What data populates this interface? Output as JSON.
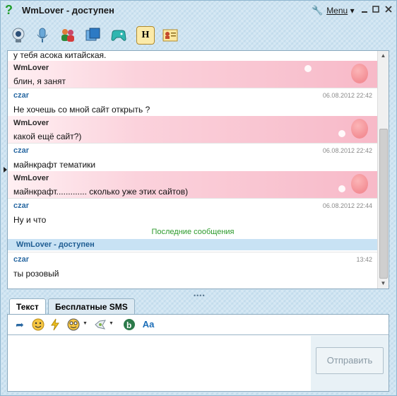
{
  "window": {
    "title": "WmLover - доступен",
    "menu_label": "Menu",
    "controls": [
      "minimize",
      "maximize",
      "close"
    ]
  },
  "toolbar": {
    "icons": [
      "webcam-icon",
      "microphone-icon",
      "contacts-icon",
      "windows-icon",
      "gamepad-icon",
      "h-icon",
      "contact-card-icon"
    ]
  },
  "chat": {
    "partial_line": "у тебя асока китайская.",
    "messages": [
      {
        "sender": "WmLover",
        "timestamp": "",
        "text": "блин, я занят",
        "kind": "partner"
      },
      {
        "sender": "czar",
        "timestamp": "06.08.2012 22:42",
        "text": "Не хочешь со мной сайт открыть ?",
        "kind": "self"
      },
      {
        "sender": "WmLover",
        "timestamp": "",
        "text": "какой ещё сайт?)",
        "kind": "partner"
      },
      {
        "sender": "czar",
        "timestamp": "06.08.2012 22:42",
        "text": "майнкрафт тематики",
        "kind": "self"
      },
      {
        "sender": "WmLover",
        "timestamp": "",
        "text": "майнкрафт............. сколько уже этих сайтов)",
        "kind": "partner"
      },
      {
        "sender": "czar",
        "timestamp": "06.08.2012 22:44",
        "text": "Ну и что",
        "kind": "self"
      }
    ],
    "last_messages_label": "Последние сообщения",
    "status_line": "WmLover - доступен",
    "recent": {
      "sender": "czar",
      "timestamp": "13:42",
      "text": "ты розовый"
    }
  },
  "tabs": [
    {
      "label": "Текст",
      "active": true
    },
    {
      "label": "Бесплатные SMS",
      "active": false
    }
  ],
  "input": {
    "value": "",
    "send_label": "Отправить"
  },
  "colors": {
    "accent": "#2b6aa3",
    "partner_header": "#f7b9c8",
    "last_messages": "#2b9a2b"
  }
}
